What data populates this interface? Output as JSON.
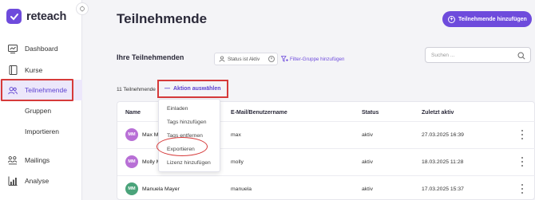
{
  "app": {
    "name": "reteach"
  },
  "sidebar": {
    "items": [
      {
        "label": "Dashboard",
        "icon": "dashboard-icon"
      },
      {
        "label": "Kurse",
        "icon": "book-icon"
      },
      {
        "label": "Teilnehmende",
        "icon": "users-icon",
        "active": true
      },
      {
        "label": "Gruppen",
        "icon": ""
      },
      {
        "label": "Importieren",
        "icon": ""
      },
      {
        "label": "Mailings",
        "icon": "mailings-icon"
      },
      {
        "label": "Analyse",
        "icon": "analytics-icon"
      }
    ]
  },
  "header": {
    "title": "Teilnehmende",
    "add_button_label": "Teilnehmende hinzufügen"
  },
  "section": {
    "title": "Ihre Teilnehmenden",
    "filter_chip": "Status ist Aktiv",
    "filter_add_label": "Filter-Gruppe hinzufügen",
    "search_placeholder": "Suchen ..."
  },
  "toolbar": {
    "count_label": "11 Teilnehmende",
    "action_label": "Aktion auswählen"
  },
  "table": {
    "headers": [
      "Name",
      "E-Mail/Benutzername",
      "Status",
      "Zuletzt aktiv"
    ],
    "rows": [
      {
        "initials": "MM",
        "name": "Max Mustermann",
        "name_visible": "Max M",
        "email": "max",
        "status": "aktiv",
        "last_active": "27.03.2025 16:39",
        "avatar_color": "#b86fd6"
      },
      {
        "initials": "MM",
        "name": "Molly Müller",
        "name_visible": "Molly M",
        "email": "molly",
        "status": "aktiv",
        "last_active": "18.03.2025 11:28",
        "avatar_color": "#b86fd6"
      },
      {
        "initials": "MM",
        "name": "Manuela Mayer",
        "name_visible": "Manuela Mayer",
        "email": "manuela",
        "status": "aktiv",
        "last_active": "17.03.2025 15:37",
        "avatar_color": "#4aa37a"
      }
    ]
  },
  "action_menu": {
    "items": [
      "Einladen",
      "Tags hinzufügen",
      "Tags entfernen",
      "Exportieren",
      "Lizenz hinzufügen"
    ],
    "highlighted": "Exportieren"
  },
  "colors": {
    "accent": "#6e4bdc",
    "highlight_red": "#d63a3a"
  }
}
